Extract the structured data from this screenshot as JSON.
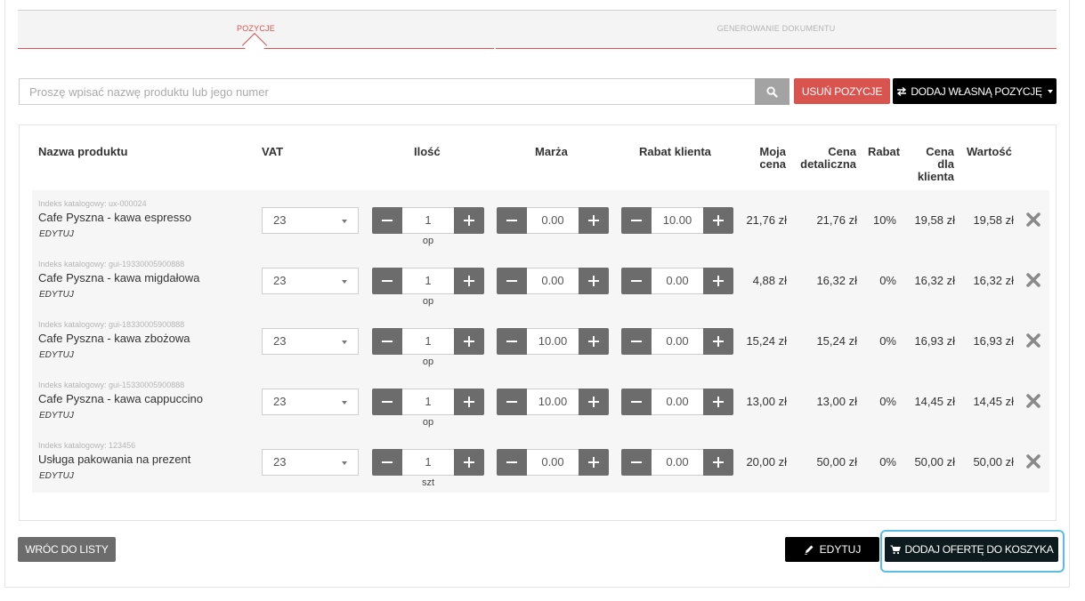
{
  "tabs": {
    "items": [
      {
        "label": "POZYCJE",
        "active": true
      },
      {
        "label": "GENEROWANIE DOKUMENTU",
        "active": false
      }
    ]
  },
  "search": {
    "placeholder": "Proszę wpisać nazwę produktu lub jego numer",
    "value": ""
  },
  "toolbar": {
    "remove_label": "USUŃ POZYCJE",
    "add_own_label": "DODAJ WŁASNĄ POZYCJĘ",
    "add_own_icon": "swap-arrows-icon"
  },
  "table": {
    "headers": {
      "name": "Nazwa produktu",
      "vat": "VAT",
      "qty": "Ilość",
      "margin": "Marża",
      "client_discount": "Rabat klienta",
      "my_price_1": "Moja",
      "my_price_2": "cena",
      "retail_1": "Cena",
      "retail_2": "detaliczna",
      "discount": "Rabat",
      "client_price_1": "Cena",
      "client_price_2": "dla",
      "client_price_3": "klienta",
      "value": "Wartość"
    },
    "edit_label": "EDYTUJ",
    "rows": [
      {
        "index": "Indeks katalogowy: ux-000024",
        "name": "Cafe Pyszna - kawa espresso",
        "vat": "23",
        "qty": "1",
        "unit": "op",
        "margin": "0.00",
        "client_discount": "10.00",
        "my_price": "21,76 zł",
        "retail_price": "21,76 zł",
        "discount": "10%",
        "client_price": "19,58 zł",
        "value": "19,58 zł"
      },
      {
        "index": "Indeks katalogowy: gui-19330005900888",
        "name": "Cafe Pyszna - kawa migdałowa",
        "vat": "23",
        "qty": "1",
        "unit": "op",
        "margin": "0.00",
        "client_discount": "0.00",
        "my_price": "4,88 zł",
        "retail_price": "16,32 zł",
        "discount": "0%",
        "client_price": "16,32 zł",
        "value": "16,32 zł"
      },
      {
        "index": "Indeks katalogowy: gui-18330005900888",
        "name": "Cafe Pyszna - kawa zbożowa",
        "vat": "23",
        "qty": "1",
        "unit": "op",
        "margin": "10.00",
        "client_discount": "0.00",
        "my_price": "15,24 zł",
        "retail_price": "15,24 zł",
        "discount": "0%",
        "client_price": "16,93 zł",
        "value": "16,93 zł"
      },
      {
        "index": "Indeks katalogowy: gui-15330005900888",
        "name": "Cafe Pyszna - kawa cappuccino",
        "vat": "23",
        "qty": "1",
        "unit": "op",
        "margin": "10.00",
        "client_discount": "0.00",
        "my_price": "13,00 zł",
        "retail_price": "13,00 zł",
        "discount": "0%",
        "client_price": "14,45 zł",
        "value": "14,45 zł"
      },
      {
        "index": "Indeks katalogowy: 123456",
        "name": "Usługa pakowania na prezent",
        "vat": "23",
        "qty": "1",
        "unit": "szt",
        "margin": "0.00",
        "client_discount": "0.00",
        "my_price": "20,00 zł",
        "retail_price": "50,00 zł",
        "discount": "0%",
        "client_price": "50,00 zł",
        "value": "50,00 zł"
      }
    ]
  },
  "footer": {
    "back_label": "WRÓC DO LISTY",
    "edit_label": "EDYTUJ",
    "add_to_cart_label": "DODAJ OFERTĘ DO KOSZYKA"
  },
  "colors": {
    "accent_red": "#d9534f",
    "stepper_gray": "#6c6c6c",
    "focus_blue": "#5bbde3"
  }
}
